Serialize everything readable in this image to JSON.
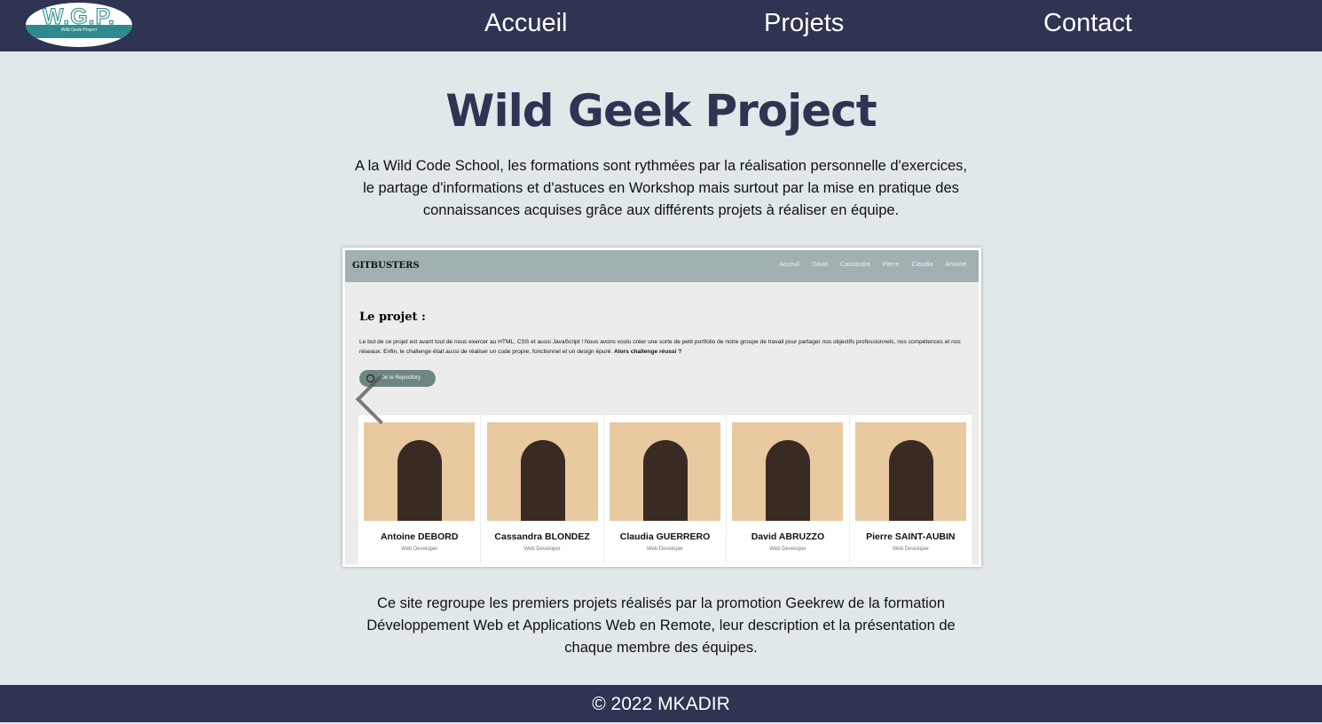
{
  "header": {
    "logo_text": "W.G.P.",
    "logo_sub": "Wild Geek Project",
    "nav": [
      "Accueil",
      "Projets",
      "Contact"
    ]
  },
  "main": {
    "title": "Wild Geek Project",
    "intro": "A la Wild Code School, les formations sont rythmées par la réalisation personnelle d'exercices, le partage d'informations et d'astuces en Workshop mais surtout par la mise en pratique des connaissances acquises grâce aux différents projets à réaliser en équipe.",
    "outro": "Ce site regroupe les premiers projets réalisés par la promotion Geekrew de la formation Développement Web et Applications Web en Remote, leur description et la présentation de chaque membre des équipes."
  },
  "carousel": {
    "brand": "GITBUSTERS",
    "nav": [
      "Acceuil",
      "David",
      "Cassandra",
      "Pierre",
      "Claudia",
      "Antoine"
    ],
    "title": "Le projet :",
    "text": "Le but de ce projet est avant tout de nous exercer au HTML, CSS et aussi JavaScript ! Nous avons voulu créer une sorte de petit portfolio de notre groupe de travail pour partager nos objectifs professionnels, nos compétences et nos réseaux. Enfin, le challenge était aussi de réaliser un code propre, fonctionnel et un design épuré.",
    "text_bold": "Alors challenge réussi ?",
    "button": "Voir le Repository",
    "members": [
      {
        "name": "Antoine DEBORD",
        "role": "Web Developer"
      },
      {
        "name": "Cassandra BLONDEZ",
        "role": "Web Developer"
      },
      {
        "name": "Claudia GUERRERO",
        "role": "Web Developer"
      },
      {
        "name": "David ABRUZZO",
        "role": "Web Developer"
      },
      {
        "name": "Pierre SAINT-AUBIN",
        "role": "Web Developer"
      }
    ]
  },
  "footer": {
    "text": "© 2022 MKADIR"
  }
}
